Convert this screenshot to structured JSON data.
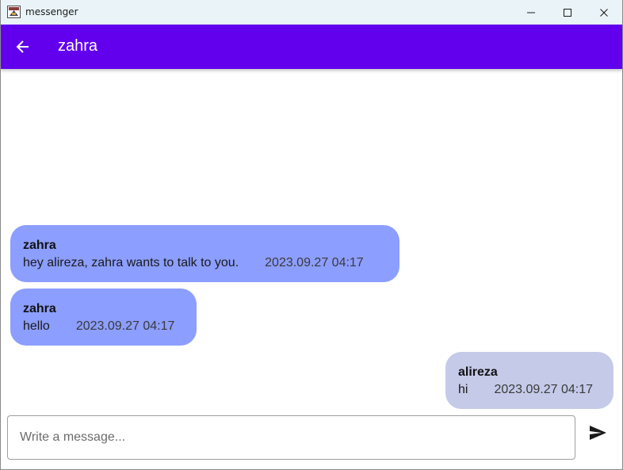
{
  "window": {
    "title": "messenger",
    "titlebar_bg": "#eaf4f8",
    "icons": [
      "app-icon",
      "minimize-icon",
      "maximize-icon",
      "close-icon"
    ]
  },
  "appbar": {
    "title": "zahra",
    "back_icon": "arrow-left-icon",
    "color": "#6200ee"
  },
  "messages": [
    {
      "sender": "zahra",
      "text": "hey alireza, zahra wants to talk to you.",
      "time": "2023.09.27 04:17",
      "direction": "incoming",
      "color": "#8c9eff"
    },
    {
      "sender": "zahra",
      "text": "hello",
      "time": "2023.09.27 04:17",
      "direction": "incoming",
      "color": "#8c9eff"
    },
    {
      "sender": "alireza",
      "text": "hi",
      "time": "2023.09.27 04:17",
      "direction": "outgoing",
      "color": "#c5cae9"
    }
  ],
  "composer": {
    "placeholder": "Write a message...",
    "value": "",
    "send_icon": "send-icon"
  }
}
